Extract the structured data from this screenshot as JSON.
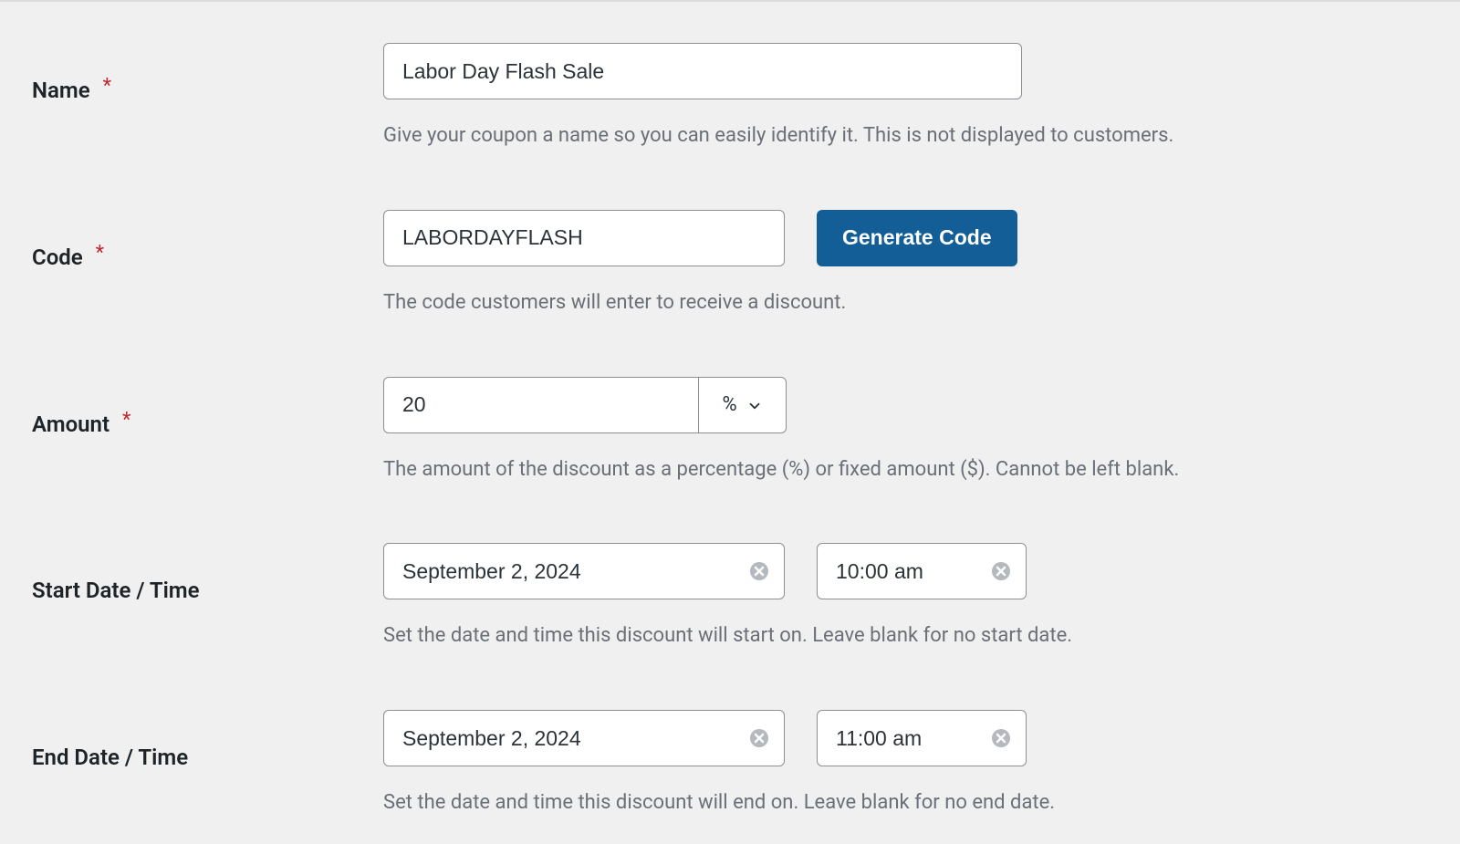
{
  "fields": {
    "name": {
      "label": "Name",
      "required": true,
      "value": "Labor Day Flash Sale",
      "helper": "Give your coupon a name so you can easily identify it. This is not displayed to customers."
    },
    "code": {
      "label": "Code",
      "required": true,
      "value": "LABORDAYFLASH",
      "generate_button": "Generate Code",
      "helper": "The code customers will enter to receive a discount."
    },
    "amount": {
      "label": "Amount",
      "required": true,
      "value": "20",
      "unit": "%",
      "helper": "The amount of the discount as a percentage (%) or fixed amount ($). Cannot be left blank."
    },
    "start": {
      "label": "Start Date / Time",
      "date": "September 2, 2024",
      "time": "10:00 am",
      "helper": "Set the date and time this discount will start on. Leave blank for no start date."
    },
    "end": {
      "label": "End Date / Time",
      "date": "September 2, 2024",
      "time": "11:00 am",
      "helper": "Set the date and time this discount will end on. Leave blank for no end date."
    }
  }
}
